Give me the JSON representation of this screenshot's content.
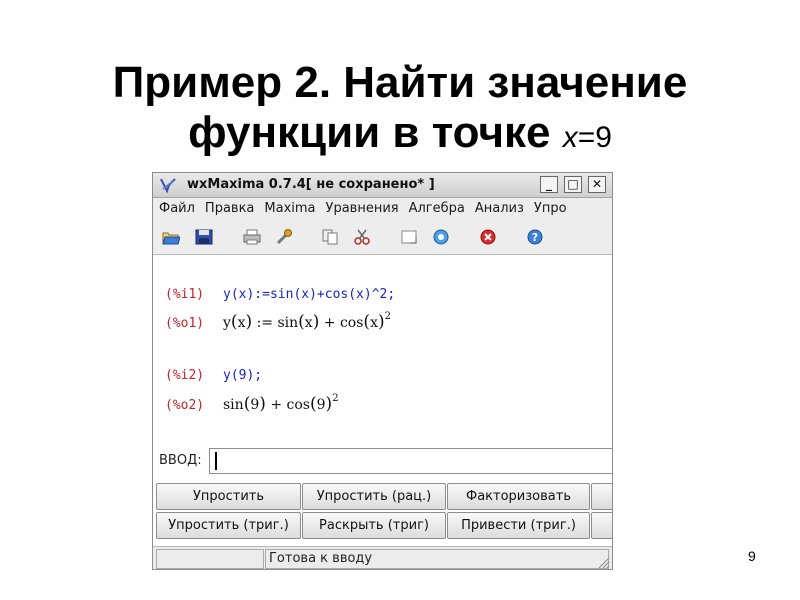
{
  "slide": {
    "title_line1": "Пример 2. Найти значение",
    "title_line2": "функции в точке ",
    "math_var": "x",
    "math_eq": "=9",
    "page_number": "9"
  },
  "window": {
    "title": "wxMaxima 0.7.4[ не сохранено* ]",
    "controls": {
      "minimize": "_",
      "maximize": "□",
      "close": "✕"
    }
  },
  "menu": [
    "Файл",
    "Правка",
    "Maxima",
    "Уравнения",
    "Алгебра",
    "Анализ",
    "Упро"
  ],
  "toolbar_icons": [
    "open-icon",
    "save-icon",
    "print-icon",
    "config-icon",
    "copy-icon",
    "cut-icon",
    "select-icon",
    "interrupt-icon",
    "stop-icon",
    "help-icon"
  ],
  "worksheet": {
    "i1_label": "(%i1)",
    "i1_input": "y(x):=sin(x)+cos(x)^2;",
    "o1_label": "(%o1)",
    "o1_y": "y",
    "o1_x1": "x",
    "o1_def": ":= sin",
    "o1_x2": "x",
    "o1_plus": "+ cos",
    "o1_x3": "x",
    "o1_exp": "2",
    "i2_label": "(%i2)",
    "i2_input": "y(9);",
    "o2_label": "(%o2)",
    "o2_sin": "sin",
    "o2_a1": "9",
    "o2_plus": "+ cos",
    "o2_a2": "9",
    "o2_exp": "2"
  },
  "input": {
    "label": "ВВОД:",
    "value": ""
  },
  "buttons": {
    "row1": [
      "Упростить",
      "Упростить (рац.)",
      "Факторизовать",
      ""
    ],
    "row2": [
      "Упростить (триг.)",
      "Раскрыть (триг)",
      "Привести (триг.)",
      ""
    ]
  },
  "status": {
    "left": "",
    "text": "Готова к вводу"
  },
  "colors": {
    "input_label": "#c8202a",
    "input_code": "#1a24c8"
  }
}
